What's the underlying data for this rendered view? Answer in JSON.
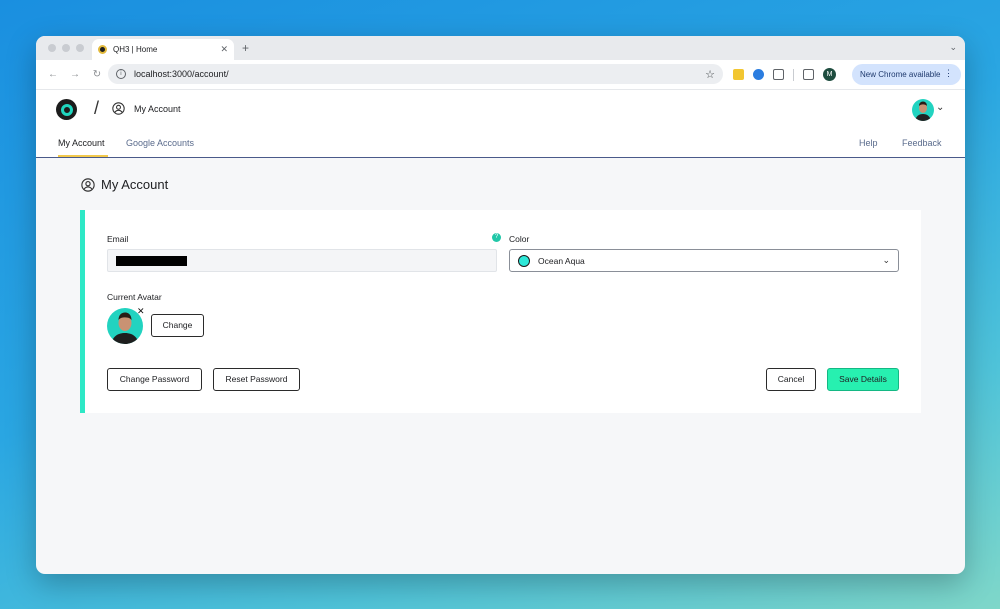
{
  "browser": {
    "tab_title": "QH3 | Home",
    "tab_close": "✕",
    "new_tab": "+",
    "tabstrip_menu": "⌄",
    "url": "localhost:3000/account/",
    "info_glyph": "i",
    "star_glyph": "☆",
    "nav": {
      "back": "←",
      "forward": "→",
      "reload": "↻"
    },
    "profile_initial": "M",
    "update_label": "New Chrome available",
    "menu_glyph": "⋮"
  },
  "header": {
    "crumb_separator": "/",
    "crumb_label": "My Account",
    "avatar_chevron": "⌄"
  },
  "subnav": {
    "items": [
      {
        "label": "My Account",
        "active": true
      },
      {
        "label": "Google Accounts",
        "active": false
      }
    ],
    "help": "Help",
    "feedback": "Feedback"
  },
  "page": {
    "title": "My Account"
  },
  "form": {
    "email_label": "Email",
    "help_glyph": "?",
    "color_label": "Color",
    "color_value": "Ocean Aqua",
    "color_hex": "#2ee8d8",
    "select_chevron": "⌄",
    "avatar_label": "Current Avatar",
    "avatar_remove": "✕",
    "change_button": "Change",
    "change_password_button": "Change Password",
    "reset_password_button": "Reset Password",
    "cancel_button": "Cancel",
    "save_button": "Save Details"
  },
  "colors": {
    "accent": "#2ee8c6",
    "save_button": "#27f0b0",
    "active_tab_underline": "#f2c94c"
  },
  "icons": [
    "info-icon",
    "star-icon",
    "extension-icon",
    "puzzle-icon",
    "side-panel-icon",
    "user-circle-icon",
    "chevron-down-icon",
    "close-icon",
    "help-icon"
  ]
}
